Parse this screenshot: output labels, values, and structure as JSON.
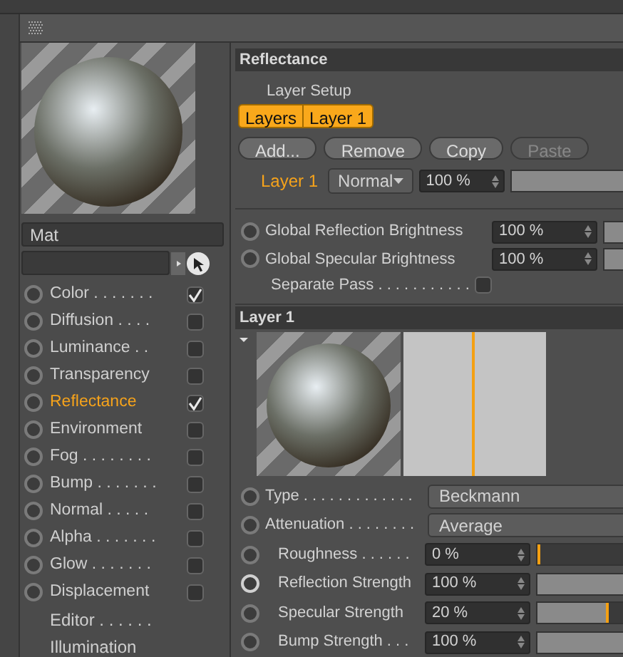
{
  "material_name": "Mat",
  "channels": [
    {
      "kind": "channel",
      "label": "Color . . . . . . .",
      "checked": true,
      "selected": false
    },
    {
      "kind": "channel",
      "label": "Diffusion . . . .",
      "checked": false,
      "selected": false
    },
    {
      "kind": "channel",
      "label": "Luminance . .",
      "checked": false,
      "selected": false
    },
    {
      "kind": "channel",
      "label": "Transparency",
      "checked": false,
      "selected": false
    },
    {
      "kind": "channel",
      "label": "Reflectance",
      "checked": true,
      "selected": true
    },
    {
      "kind": "channel",
      "label": "Environment",
      "checked": false,
      "selected": false
    },
    {
      "kind": "channel",
      "label": "Fog . . . . . . . .",
      "checked": false,
      "selected": false
    },
    {
      "kind": "channel",
      "label": "Bump . . . . . . .",
      "checked": false,
      "selected": false
    },
    {
      "kind": "channel",
      "label": "Normal . . . . .",
      "checked": false,
      "selected": false
    },
    {
      "kind": "channel",
      "label": "Alpha . . . . . . .",
      "checked": false,
      "selected": false
    },
    {
      "kind": "channel",
      "label": "Glow . . . . . . .",
      "checked": false,
      "selected": false
    },
    {
      "kind": "channel",
      "label": "Displacement",
      "checked": false,
      "selected": false
    },
    {
      "kind": "plain",
      "label": "Editor . . . . . ."
    },
    {
      "kind": "plain",
      "label": "Illumination"
    }
  ],
  "section_title": "Reflectance",
  "layer_setup": {
    "label": "Layer Setup",
    "tabs": [
      {
        "label": "Layers",
        "selected": true
      },
      {
        "label": "Layer 1",
        "selected": true
      }
    ],
    "buttons": [
      {
        "label": "Add...",
        "disabled": false
      },
      {
        "label": "Remove",
        "disabled": false
      },
      {
        "label": "Copy",
        "disabled": false
      },
      {
        "label": "Paste",
        "disabled": true
      }
    ],
    "layer": {
      "name": "Layer 1",
      "blend_mode": "Normal",
      "opacity": "100 %",
      "level": 1
    }
  },
  "global": [
    {
      "label": "Global Reflection Brightness",
      "value": "100 %",
      "level": 1
    },
    {
      "label": "Global Specular Brightness",
      "value": "100 %",
      "level": 1
    }
  ],
  "separate_pass": {
    "label": "Separate Pass . . . . . . . . . . .",
    "checked": false
  },
  "layer_title": "Layer 1",
  "properties": [
    {
      "kind": "dropdown",
      "label": "Type . . . . . . . . . . . . .",
      "value": "Beckmann",
      "key_active": false
    },
    {
      "kind": "dropdown",
      "label": "Attenuation . . . . . . . .",
      "value": "Average",
      "key_active": false
    },
    {
      "kind": "slider",
      "label": "Roughness . . . . . .",
      "value": "0 %",
      "level": 0,
      "key_active": false
    },
    {
      "kind": "slider",
      "label": "Reflection Strength",
      "value": "100 %",
      "level": 1,
      "key_active": true
    },
    {
      "kind": "slider",
      "label": "Specular Strength",
      "value": "20 %",
      "level": 0.2,
      "key_active": false
    },
    {
      "kind": "slider",
      "label": "Bump Strength . . .",
      "value": "100 %",
      "level": 1,
      "key_active": false
    }
  ]
}
